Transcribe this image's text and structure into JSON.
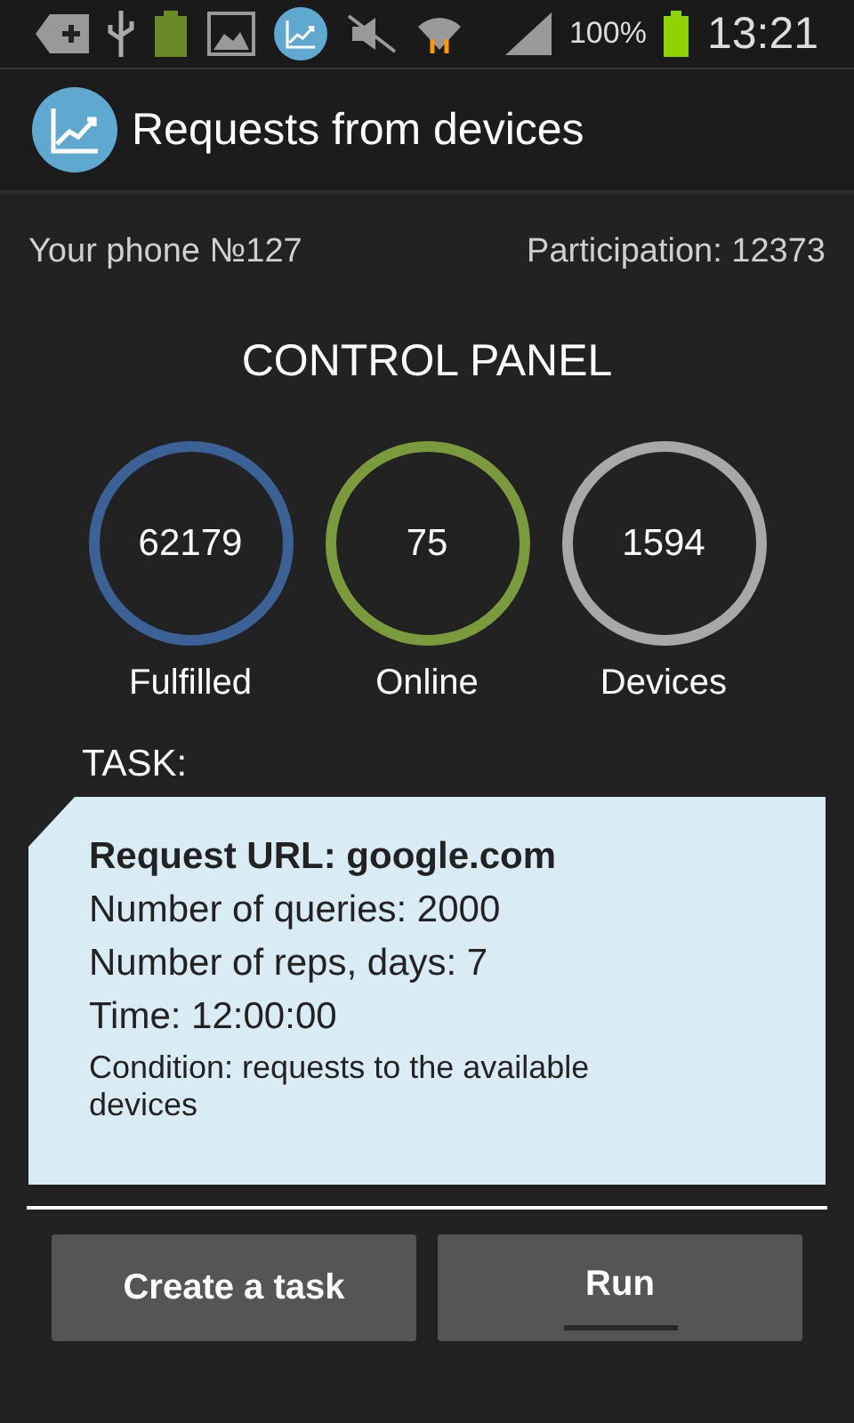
{
  "status_bar": {
    "battery_text": "100%",
    "time": "13:21"
  },
  "app_bar": {
    "title": "Requests from devices"
  },
  "info": {
    "phone": "Your phone №127",
    "participation": "Participation: 12373"
  },
  "panel_title": "CONTROL PANEL",
  "stats": [
    {
      "value": "62179",
      "label": "Fulfilled",
      "color": "#3c6196"
    },
    {
      "value": "75",
      "label": "Online",
      "color": "#7a9a3c"
    },
    {
      "value": "1594",
      "label": "Devices",
      "color": "#a8a8a8"
    }
  ],
  "task": {
    "heading": "TASK:",
    "lines": [
      {
        "text": "Request URL: google.com",
        "kind": "bold"
      },
      {
        "text": "Number of queries: 2000",
        "kind": "normal"
      },
      {
        "text": "Number of reps, days: 7",
        "kind": "normal"
      },
      {
        "text": "Time: 12:00:00",
        "kind": "normal"
      },
      {
        "text": "Condition: requests to the available devices",
        "kind": "small"
      }
    ]
  },
  "buttons": [
    {
      "label": "Create a task",
      "selected": false
    },
    {
      "label": "Run",
      "selected": true
    }
  ]
}
